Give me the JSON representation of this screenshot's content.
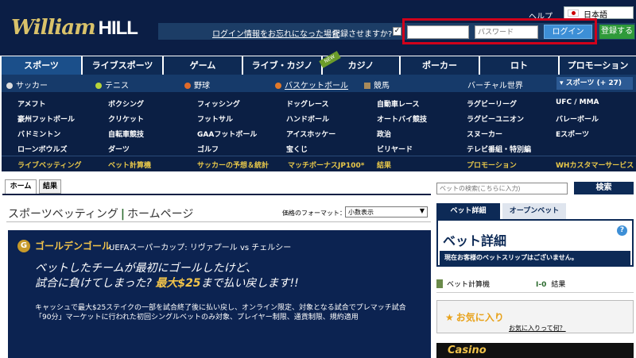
{
  "header": {
    "logo_main": "William",
    "logo_bold": "HILL",
    "help": "ヘルプ",
    "language": "日本語",
    "forgot_login": "ログイン情報をお忘れになった場合",
    "remember_label": "記録させますか?",
    "username_placeholder": "",
    "password_placeholder": "パスワード",
    "login_button": "ログイン",
    "register_button": "登録する"
  },
  "nav": {
    "tabs": [
      "スポーツ",
      "ライブスポーツ",
      "ゲーム",
      "ライブ・カジノ",
      "カジノ",
      "ポーカー",
      "ロト",
      "プロモーション"
    ],
    "new_tag": "NEW"
  },
  "subnav": {
    "items": [
      "サッカー",
      "テニス",
      "野球",
      "バスケットボール",
      "競馬",
      "バーチャル世界"
    ],
    "sports_button": "▾ スポーツ (+ 27)"
  },
  "sports_grid": [
    [
      "アメフト",
      "ボクシング",
      "フィッシング",
      "ドッグレース",
      "自動車レース",
      "ラグビーリーグ",
      "UFC / MMA"
    ],
    [
      "豪州フットボール",
      "クリケット",
      "フットサル",
      "ハンドボール",
      "オートバイ競技",
      "ラグビーユニオン",
      "バレーボール"
    ],
    [
      "バドミントン",
      "自転車競技",
      "GAAフットボール",
      "アイスホッケー",
      "政治",
      "スヌーカー",
      "Eスポーツ"
    ],
    [
      "ローンボウルズ",
      "ダーツ",
      "ゴルフ",
      "宝くじ",
      "ビリヤード",
      "テレビ番組・特別編",
      ""
    ]
  ],
  "quicklinks": [
    "ライブベッティング",
    "ベット計算機",
    "サッカーの予想＆統計",
    "マッチボーナスJP100*",
    "結果",
    "プロモーション",
    "WHカスタマーサービス"
  ],
  "main": {
    "tabs": [
      "ホーム",
      "結果"
    ],
    "title_a": "スポーツベッティング",
    "title_sep": "|",
    "title_b": "ホームページ",
    "odds_label": "価格のフォーマット：",
    "odds_value": "小数表示"
  },
  "promo": {
    "badge": "G",
    "title": "ゴールデンゴール",
    "subtitle": "UEFAスーパーカップ: リヴァプール vs チェルシー",
    "headline1": "ベットしたチームが最初にゴールしたけど、",
    "headline2a": "試合に負けてしまった?",
    "headline2b": "最大$25",
    "headline2c": "まで払い戻します!!",
    "body": "キャッシュで最大$25ステイクの一部を試合終了後に払い戻し、オンライン限定、対象となる試合でプレマッチ試合「90分」マーケットに行われた初回シングルベットのみ対象、プレイヤー制限、通貨制限、規約適用"
  },
  "sidebar": {
    "search_placeholder": "ベットの検索(こちらに入力)",
    "search_button": "検索",
    "tabs": [
      "ベット詳細",
      "オープンベット"
    ],
    "betslip_title": "ベット詳細",
    "help_icon_text": "?",
    "betslip_message": "現在お客様のベットスリップはございません。",
    "calc_label": "ベット計算機",
    "results_icon": "I-0",
    "results_label": "結果",
    "fav_title": "お気に入り",
    "fav_link": "お気に入りって何？",
    "casino": "Casino"
  },
  "colors": {
    "navy": "#0b1e45",
    "gold": "#f1c34a",
    "highlight": "#d0021b"
  }
}
